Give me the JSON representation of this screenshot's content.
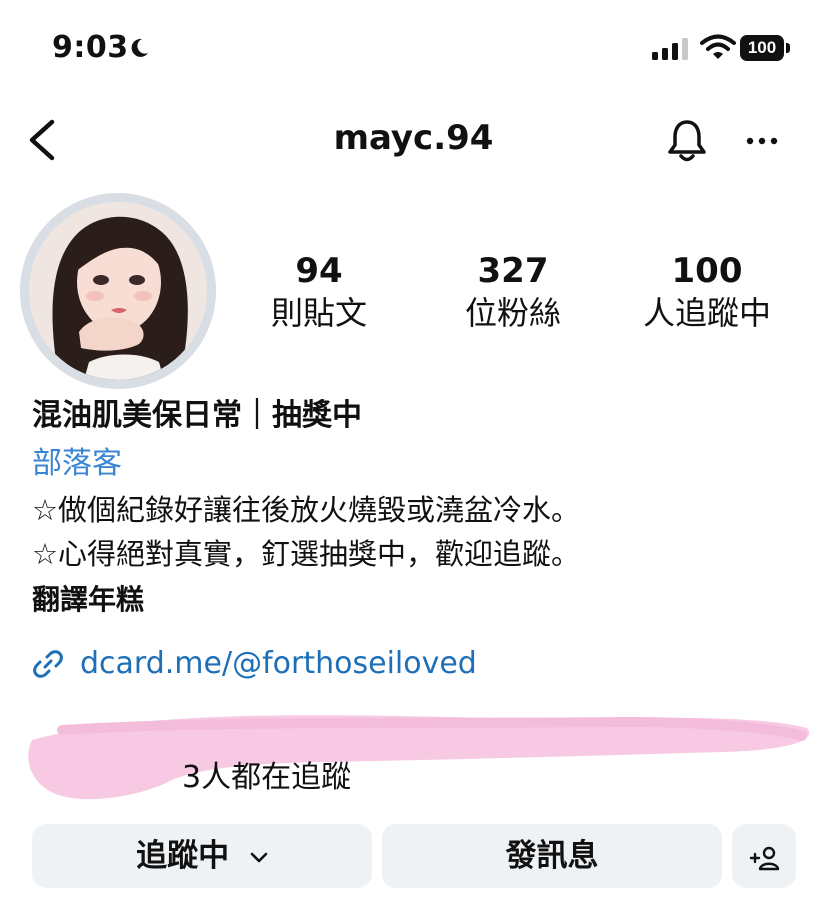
{
  "status_bar": {
    "time": "9:03",
    "battery": "100",
    "icons": [
      "moon-icon",
      "signal-icon",
      "wifi-icon",
      "battery-icon"
    ]
  },
  "header": {
    "username": "mayc.94",
    "icons": [
      "back-chevron-icon",
      "bell-icon",
      "more-icon"
    ]
  },
  "profile": {
    "stats": {
      "posts": {
        "value": "94",
        "label": "則貼文"
      },
      "followers": {
        "value": "327",
        "label": "位粉絲"
      },
      "following": {
        "value": "100",
        "label": "人追蹤中"
      }
    },
    "name": "混油肌美保日常｜抽獎中",
    "category": "部落客",
    "bio_lines": [
      "☆做個紀錄好讓往後放火燒毀或澆盆冷水。",
      "☆心得絕對真實，釘選抽獎中，歡迎追蹤。"
    ],
    "translate_label": "翻譯年糕",
    "link": "dcard.me/@forthoseiloved",
    "mutual_followers": "3人都在追蹤"
  },
  "actions": {
    "following_label": "追蹤中",
    "message_label": "發訊息",
    "add_person_icon": "add-person-icon"
  },
  "colors": {
    "accent_link": "#1d6fb8",
    "category": "#3a84d4",
    "button_bg": "#eff2f5",
    "redaction_pink": "#f7c9e3"
  }
}
